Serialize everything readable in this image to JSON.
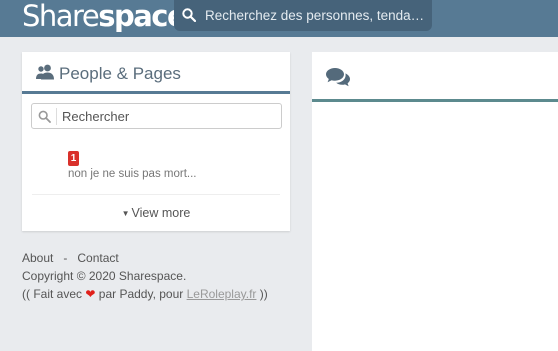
{
  "header": {
    "logo_part1": "Share",
    "logo_part2": "space",
    "search_placeholder": "Recherchez des personnes, tendances..."
  },
  "people_panel": {
    "title": "People & Pages",
    "search_placeholder": "Rechercher",
    "items": [
      {
        "badge": "1",
        "text": "non je ne suis pas mort..."
      }
    ],
    "view_more": "View more"
  },
  "footer": {
    "about": "About",
    "separator": "-",
    "contact": "Contact",
    "copyright": "Copyright © 2020 Sharespace.",
    "made_prefix": "(( Fait avec",
    "made_middle": "par Paddy, pour",
    "made_link": "LeRoleplay.fr",
    "made_suffix": "))"
  },
  "colors": {
    "topbar": "#577a94",
    "search_bg": "#46637a",
    "panel_left_border": "#577a94",
    "panel_right_border": "#5c8a8e",
    "badge": "#d9312b",
    "heart": "#e0201a"
  },
  "icons": {
    "top_search": "search-icon",
    "people": "people-icon",
    "panel_search": "search-icon",
    "caret": "caret-down-icon",
    "heart": "heart-icon",
    "chat": "comments-icon"
  }
}
